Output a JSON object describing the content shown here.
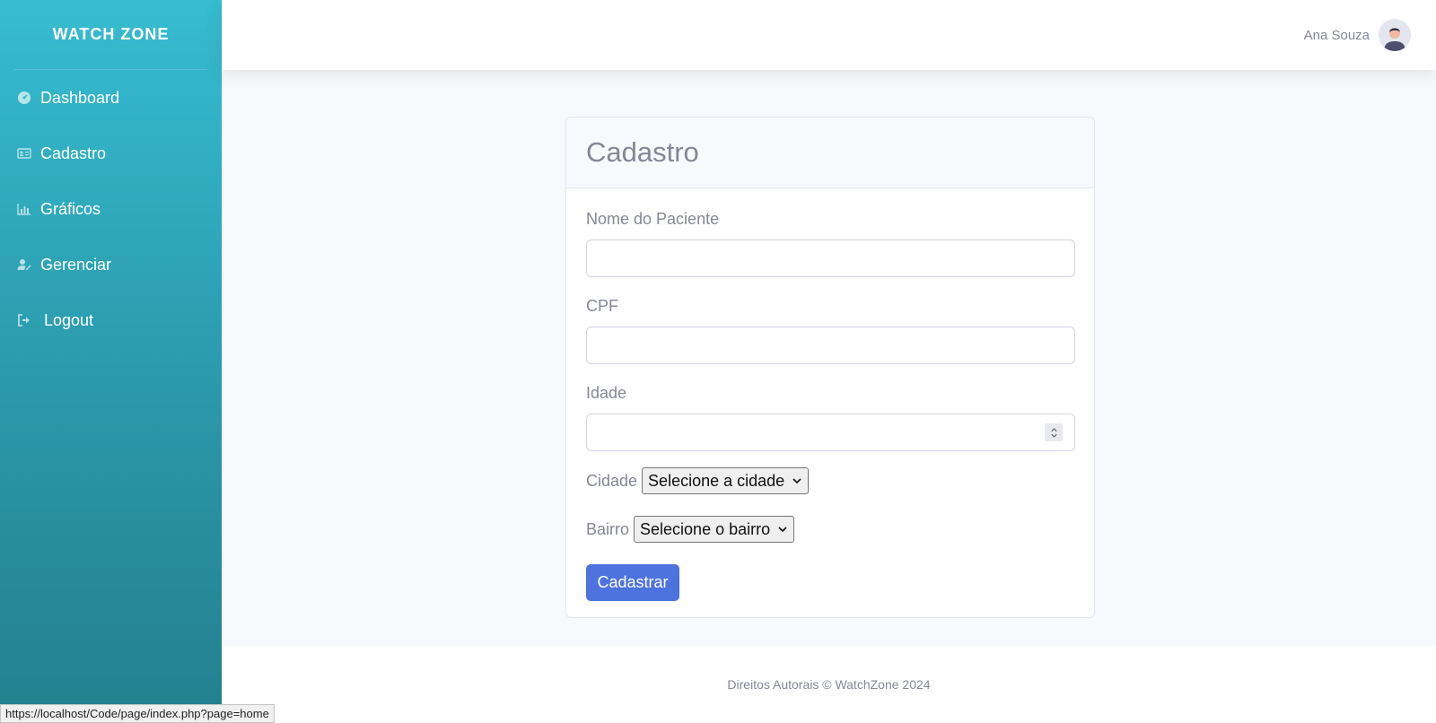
{
  "sidebar": {
    "brand": "WATCH ZONE",
    "items": [
      {
        "label": "Dashboard",
        "icon": "gauge-icon"
      },
      {
        "label": "Cadastro",
        "icon": "id-card-icon"
      },
      {
        "label": "Gráficos",
        "icon": "chart-icon"
      },
      {
        "label": "Gerenciar",
        "icon": "user-edit-icon"
      },
      {
        "label": "Logout",
        "icon": "sign-out-icon"
      }
    ]
  },
  "topbar": {
    "user_name": "Ana Souza"
  },
  "form": {
    "title": "Cadastro",
    "fields": {
      "nome_label": "Nome do Paciente",
      "nome_value": "",
      "cpf_label": "CPF",
      "cpf_value": "",
      "idade_label": "Idade",
      "idade_value": ""
    },
    "cidade_label": "Cidade",
    "cidade_selected": "Selecione a cidade",
    "bairro_label": "Bairro",
    "bairro_selected": "Selecione o bairro",
    "submit_label": "Cadastrar"
  },
  "footer": {
    "text": "Direitos Autorais © WatchZone 2024"
  },
  "statusbar": {
    "url": "https://localhost/Code/page/index.php?page=home"
  },
  "colors": {
    "sidebar_top": "#36bcd1",
    "sidebar_bottom": "#247f8e",
    "primary": "#4e73df",
    "text_muted": "#858796",
    "background": "#f8f9fc"
  }
}
